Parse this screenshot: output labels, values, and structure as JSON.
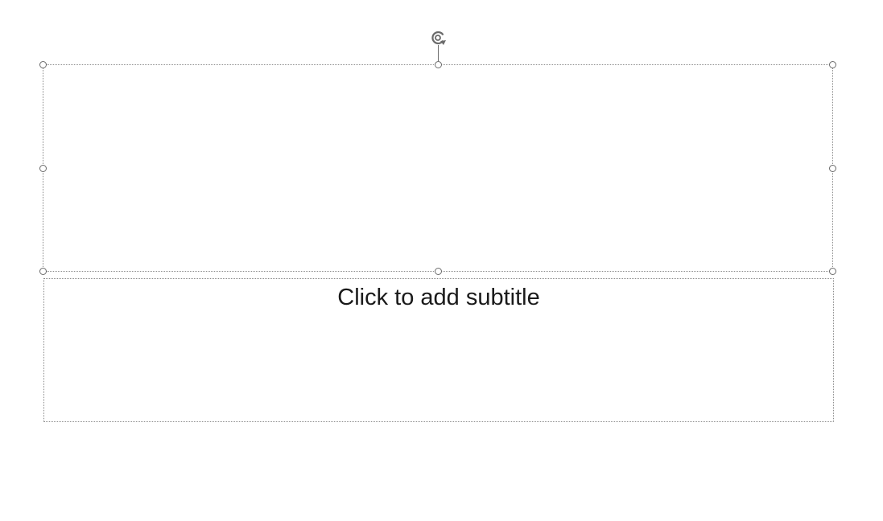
{
  "slide": {
    "title_placeholder": {
      "text": ""
    },
    "subtitle_placeholder": {
      "text": "Click to add subtitle"
    }
  },
  "icons": {
    "rotate": "rotate-handle-icon"
  },
  "colors": {
    "background": "#ffffff",
    "placeholder_border": "#8a8a8a",
    "handle": "#6b6b6b",
    "text": "#1a1a1a"
  }
}
